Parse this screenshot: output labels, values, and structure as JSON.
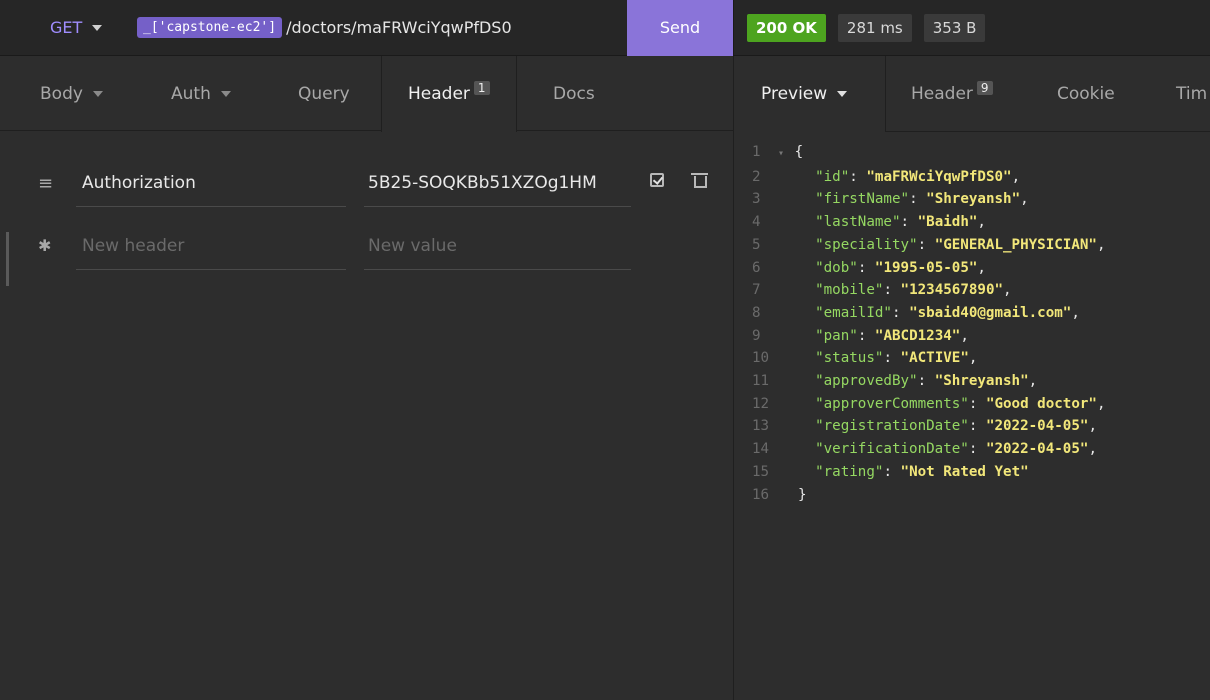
{
  "request": {
    "method": "GET",
    "env_tag": "_['capstone-ec2']",
    "path": "/doctors/maFRWciYqwPfDS0",
    "send_label": "Send"
  },
  "response_meta": {
    "status": "200 OK",
    "time": "281 ms",
    "size": "353 B"
  },
  "request_tabs": {
    "body": "Body",
    "auth": "Auth",
    "query": "Query",
    "header": "Header",
    "header_count": "1",
    "docs": "Docs"
  },
  "headers": [
    {
      "name": "Authorization",
      "value": "​5B25-SOQKBb51XZOg1HM"
    }
  ],
  "new_header": {
    "name_placeholder": "New header",
    "value_placeholder": "New value"
  },
  "response_tabs": {
    "preview": "Preview",
    "header": "Header",
    "header_count": "9",
    "cookie": "Cookie",
    "timeline": "Tim"
  },
  "response_body": {
    "open_brace": "{",
    "close_brace": "}",
    "fields": [
      {
        "key": "\"id\"",
        "value": "\"maFRWciYqwPfDS0\""
      },
      {
        "key": "\"firstName\"",
        "value": "\"Shreyansh\""
      },
      {
        "key": "\"lastName\"",
        "value": "\"Baidh\""
      },
      {
        "key": "\"speciality\"",
        "value": "\"GENERAL_PHYSICIAN\""
      },
      {
        "key": "\"dob\"",
        "value": "\"1995-05-05\""
      },
      {
        "key": "\"mobile\"",
        "value": "\"1234567890\""
      },
      {
        "key": "\"emailId\"",
        "value": "\"sbaid40@gmail.com\""
      },
      {
        "key": "\"pan\"",
        "value": "\"ABCD1234\""
      },
      {
        "key": "\"status\"",
        "value": "\"ACTIVE\""
      },
      {
        "key": "\"approvedBy\"",
        "value": "\"Shreyansh\""
      },
      {
        "key": "\"approverComments\"",
        "value": "\"Good doctor\""
      },
      {
        "key": "\"registrationDate\"",
        "value": "\"2022-04-05\""
      },
      {
        "key": "\"verificationDate\"",
        "value": "\"2022-04-05\""
      },
      {
        "key": "\"rating\"",
        "value": "\"Not Rated Yet\""
      }
    ]
  }
}
